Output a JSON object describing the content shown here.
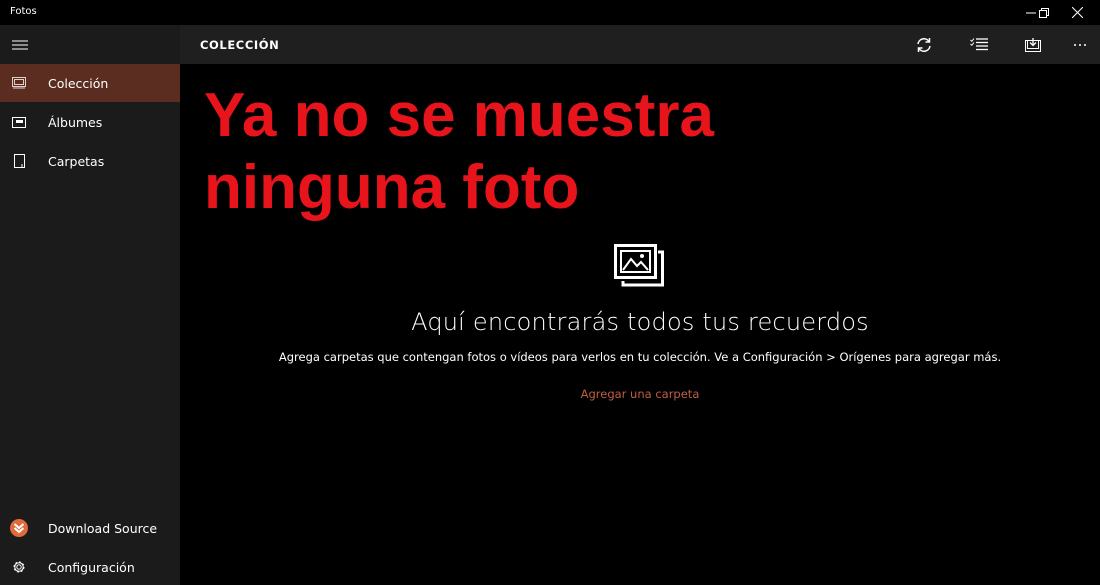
{
  "window": {
    "title": "Fotos",
    "controls": {
      "minimize": "minimize-icon",
      "maximize": "restore-icon",
      "close": "close-icon"
    }
  },
  "sidebar": {
    "menu_icon": "hamburger-icon",
    "items": [
      {
        "label": "Colección",
        "icon": "collection-icon",
        "selected": true
      },
      {
        "label": "Álbumes",
        "icon": "album-icon",
        "selected": false
      },
      {
        "label": "Carpetas",
        "icon": "folder-icon",
        "selected": false
      }
    ],
    "bottom_items": [
      {
        "label": "Download Source",
        "icon": "download-source-logo"
      },
      {
        "label": "Configuración",
        "icon": "gear-icon"
      }
    ]
  },
  "header": {
    "title": "COLECCIÓN",
    "toolbar": [
      {
        "name": "refresh",
        "icon": "refresh-icon"
      },
      {
        "name": "select",
        "icon": "checklist-icon"
      },
      {
        "name": "import",
        "icon": "import-icon"
      },
      {
        "name": "more",
        "icon": "more-icon",
        "label": "···"
      }
    ]
  },
  "overlay": {
    "text": "Ya no se muestra ninguna foto",
    "color": "#e8141c"
  },
  "empty_state": {
    "icon": "photos-stack-icon",
    "title": "Aquí encontrarás todos tus recuerdos",
    "description": "Agrega carpetas que contengan fotos o vídeos para verlos en tu colección. Ve a Configuración > Orígenes para agregar más.",
    "action_label": "Agregar una carpeta"
  },
  "colors": {
    "accent": "#c05d45",
    "selected_nav": "#5a2d20",
    "sidebar_bg": "#1b1b1b",
    "header_bg": "#1f1f1f"
  }
}
